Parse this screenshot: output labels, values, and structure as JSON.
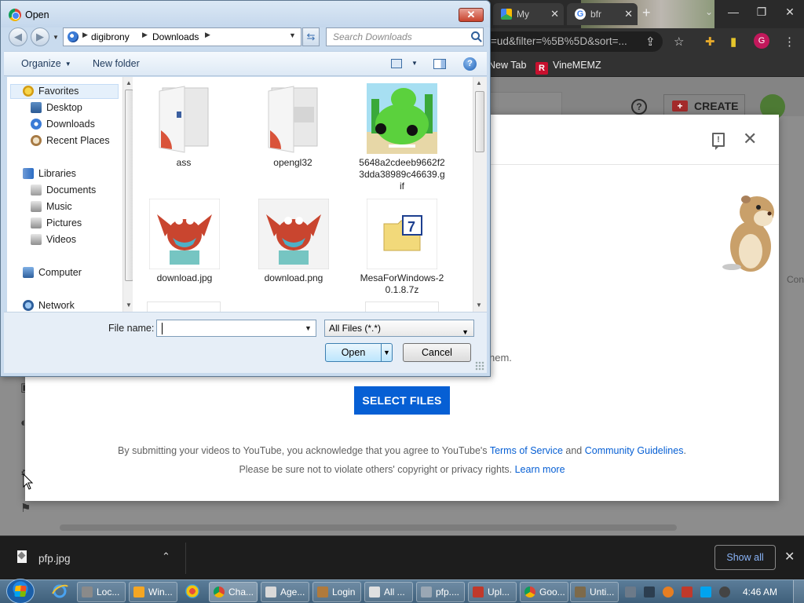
{
  "browser": {
    "tabs": [
      {
        "label": "My",
        "color": "#fbbc04"
      },
      {
        "label": "bfr",
        "color": "#ea4335"
      }
    ],
    "url": "l=ud&filter=%5B%5D&sort=...",
    "bookmarks": [
      "New Tab",
      "VineMEMZ"
    ],
    "profile_initial": "G"
  },
  "youtube": {
    "create_label": "CREATE",
    "partial_bracket": "]",
    "partial_text": "hem.",
    "select_files_label": "SELECT FILES",
    "legal_line1_before": "By submitting your videos to YouTube, you acknowledge that you agree to YouTube's ",
    "terms_link": "Terms of Service",
    "legal_line1_mid": " and ",
    "guidelines_link": "Community Guidelines",
    "legal_line1_after": ".",
    "legal_line2": "Please be sure not to violate others' copyright or privacy rights. ",
    "learn_more": "Learn more",
    "side_partial": "Con"
  },
  "open_dialog": {
    "title": "Open",
    "breadcrumb": [
      "digibrony",
      "Downloads"
    ],
    "search_placeholder": "Search Downloads",
    "organize_label": "Organize",
    "new_folder_label": "New folder",
    "nav": {
      "favorites": "Favorites",
      "desktop": "Desktop",
      "downloads": "Downloads",
      "recent": "Recent Places",
      "libraries": "Libraries",
      "documents": "Documents",
      "music": "Music",
      "pictures": "Pictures",
      "videos": "Videos",
      "computer": "Computer",
      "network": "Network"
    },
    "files": [
      {
        "name": "ass",
        "kind": "folder"
      },
      {
        "name": "opengl32",
        "kind": "folder"
      },
      {
        "name": "5648a2cdeeb9662f23dda38989c46639.gif",
        "kind": "gif"
      },
      {
        "name": "download.jpg",
        "kind": "image"
      },
      {
        "name": "download.png",
        "kind": "image"
      },
      {
        "name": "MesaForWindows-20.1.8.7z",
        "kind": "archive"
      }
    ],
    "file_name_label": "File name:",
    "file_name_value": "",
    "filter_value": "All Files (*.*)",
    "open_label": "Open",
    "cancel_label": "Cancel"
  },
  "downloads_shelf": {
    "file": "pfp.jpg",
    "show_all": "Show all"
  },
  "taskbar": {
    "buttons": [
      "Loc...",
      "Win...",
      "Cha...",
      "Age...",
      "Login",
      "All ...",
      "pfp....",
      "Upl...",
      "Goo...",
      "Unti..."
    ],
    "clock": "4:46 AM"
  }
}
